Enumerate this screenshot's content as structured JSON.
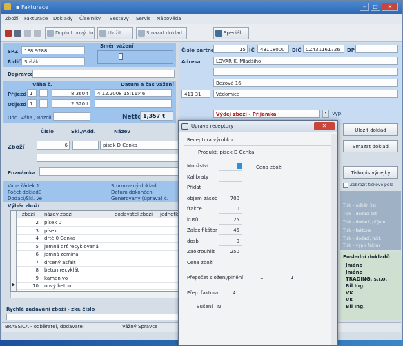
{
  "window": {
    "title": "▪ Fakturace",
    "min_icon": "minimize-icon",
    "max_icon": "maximize-icon",
    "close_icon": "close-icon"
  },
  "menu": [
    "Zboží",
    "Fakturace",
    "Doklady",
    "Číselníky",
    "Sestavy",
    "Servis",
    "Nápověda"
  ],
  "toolbar": {
    "buttons": [
      {
        "label": "Doplnit nový doklad"
      },
      {
        "label": "Uložit"
      },
      {
        "label": "Smazat doklad"
      }
    ],
    "special_label": "Speciál"
  },
  "left_header": {
    "spz_label": "SPZ",
    "spz_value": "1E8 9288",
    "rdd_label": "Řidič",
    "rdd_value": "Sušák",
    "shipment_title": "Směr vážení",
    "dopravce_label": "Dopravce",
    "weight_title": "Váha č.",
    "datetime_title": "Datum a čas vážení",
    "prijezd_label": "Příjezd",
    "prijezd_scale": "1",
    "prijezd_weight": "8,360 t",
    "prijezd_time": "4.12.2008 15:11:46",
    "odjezd_label": "Odjezd",
    "odjezd_scale": "1",
    "odjezd_weight": "2,520 t",
    "odd_label": "Odd. váha / Rozdíl",
    "netto_label": "Netto",
    "netto_value": "1,357 t"
  },
  "right_header": {
    "cp_label": "Číslo partnera",
    "cp_value": "15",
    "ic_label": "IČ",
    "ic_value": "43118000",
    "dic_label": "DIČ",
    "dic_value": "CZ431161726",
    "dp_label": "DP",
    "adresa_label": "Adresa",
    "adresa_value": "LOVAR K. Mladšího",
    "street_value": "Bezová 16",
    "psc_value": "411 31",
    "city_value": "Vědomice",
    "type_value": "Výdej zboží - Příjemka",
    "type_extra": "Vyp."
  },
  "goods": {
    "cislo_label": "Číslo",
    "mnozstvi_label": "Skl./Add.",
    "nazev_label": "Název",
    "zbozi_label": "Zboží",
    "zbozi_cislo": "6",
    "zbozi_nazev": "písek D Cenka",
    "poznamka_label": "Poznámka"
  },
  "summary": {
    "left": [
      "Váha řádek 1",
      "Počet dokladů",
      "Dodací/Skl. ve"
    ],
    "right": [
      "Stornovaný doklad",
      "Datum dokončení",
      "Generovaný (úprava) č."
    ]
  },
  "grid": {
    "title": "Výběr zboží",
    "headers": [
      "zboží",
      "název zboží",
      "dodavatel zboží",
      "jednotka"
    ],
    "rows": [
      {
        "n": "2",
        "name": "písek 0"
      },
      {
        "n": "3",
        "name": "písek"
      },
      {
        "n": "4",
        "name": "drtě 0 Cenka"
      },
      {
        "n": "5",
        "name": "jemná drť recyklovaná"
      },
      {
        "n": "6",
        "name": "jemná zemina"
      },
      {
        "n": "7",
        "name": "drcený asfalt"
      },
      {
        "n": "8",
        "name": "beton recyklát"
      },
      {
        "n": "9",
        "name": "kamenivo"
      },
      {
        "n": "10",
        "name": "nový beton"
      }
    ],
    "rychle_label": "Rychlé zadávání zboží - zkr. číslo"
  },
  "statusbar": {
    "left": "BRASSICA - odběratel, dodavatel",
    "mid": "Vážný Správce"
  },
  "dialog": {
    "title": "Úprava receptury",
    "close_icon": "close-icon",
    "header_label": "Receptura výrobku",
    "product_label": "Produkt: písek D Cenka",
    "rows": [
      {
        "label": "Množství",
        "value": ""
      },
      {
        "label": "Kalibraty",
        "value": ""
      },
      {
        "label": "Přidat",
        "value": ""
      },
      {
        "label": "objem zásob",
        "value": "700"
      },
      {
        "label": "frakce",
        "value": "0"
      },
      {
        "label": "kusů",
        "value": "25"
      },
      {
        "label": "Zalexifikátor",
        "value": "45"
      },
      {
        "label": "dosb",
        "value": "0"
      },
      {
        "label": "Zaokrouhlit",
        "value": "250"
      },
      {
        "label": "Cena zboží",
        "value": ""
      }
    ],
    "side_label": "Cena zboží",
    "bottom1_label": "Přepočet složení/plnění",
    "bottom1_val1": "1",
    "bottom1_val2": "1",
    "bottom2_label": "Přep. faktura",
    "bottom2_value": "4",
    "bottom3_label": "Sušení",
    "bottom3_value": "N"
  },
  "right_buttons": {
    "novy": "Uložit doklad",
    "smazat": "Smazat doklad",
    "tisk": "Tiskopis výdejky",
    "checkbox": "Zobrazit tiskové pole"
  },
  "right_list": {
    "items": [
      "Tisk – odběr. list",
      "Tisk – dodací list",
      "Tisk – dodací, příjem",
      "Tisk – faktura",
      "Tisk – dodací, fakt.",
      "Tisk – výpis faktur"
    ],
    "header": "Poslední dokladů",
    "names": [
      "Jméno",
      "Jméno",
      "TRADING, s.r.o.",
      "Bil Ing.",
      "VK",
      "VK",
      "Bil Ing."
    ]
  }
}
